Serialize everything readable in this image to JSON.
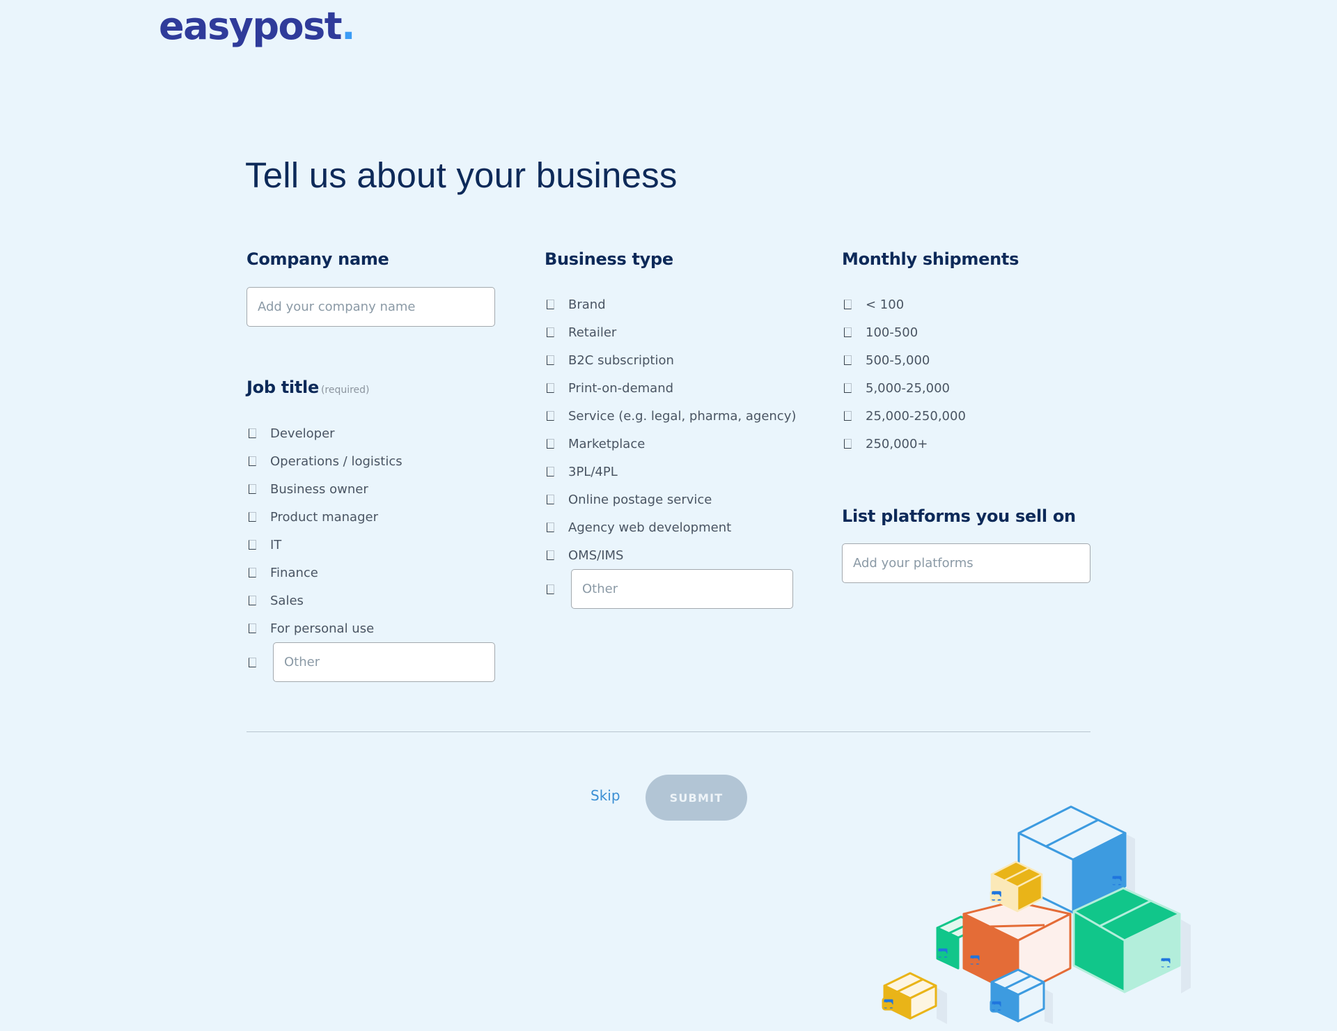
{
  "brand": {
    "name": "easypost",
    "dot": ".",
    "accent": "#3b9cf5",
    "logo_color": "#2f3b9a"
  },
  "page": {
    "title": "Tell us about your business",
    "background": "#eaf5fc"
  },
  "company": {
    "heading": "Company name",
    "placeholder": "Add your company name",
    "value": ""
  },
  "job_title": {
    "heading": "Job title",
    "required_note": "(required)",
    "options": [
      {
        "label": "Developer",
        "checked": false
      },
      {
        "label": "Operations / logistics",
        "checked": false
      },
      {
        "label": "Business owner",
        "checked": false
      },
      {
        "label": "Product manager",
        "checked": false
      },
      {
        "label": "IT",
        "checked": false
      },
      {
        "label": "Finance",
        "checked": false
      },
      {
        "label": "Sales",
        "checked": false
      },
      {
        "label": "For personal use",
        "checked": false
      }
    ],
    "other_placeholder": "Other",
    "other_value": ""
  },
  "business_type": {
    "heading": "Business type",
    "options": [
      {
        "label": "Brand",
        "checked": false
      },
      {
        "label": "Retailer",
        "checked": false
      },
      {
        "label": "B2C subscription",
        "checked": false
      },
      {
        "label": "Print-on-demand",
        "checked": false
      },
      {
        "label": "Service (e.g. legal, pharma, agency)",
        "checked": false
      },
      {
        "label": "Marketplace",
        "checked": false
      },
      {
        "label": "3PL/4PL",
        "checked": false
      },
      {
        "label": "Online postage service",
        "checked": false
      },
      {
        "label": "Agency web development",
        "checked": false
      },
      {
        "label": "OMS/IMS",
        "checked": false
      }
    ],
    "other_placeholder": "Other",
    "other_value": ""
  },
  "monthly_shipments": {
    "heading": "Monthly shipments",
    "options": [
      {
        "label": "< 100",
        "checked": false
      },
      {
        "label": "100-500",
        "checked": false
      },
      {
        "label": "500-5,000",
        "checked": false
      },
      {
        "label": "5,000-25,000",
        "checked": false
      },
      {
        "label": "25,000-250,000",
        "checked": false
      },
      {
        "label": "250,000+",
        "checked": false
      }
    ]
  },
  "platforms": {
    "heading": "List platforms you sell on",
    "placeholder": "Add your platforms",
    "value": ""
  },
  "actions": {
    "skip_label": "Skip",
    "submit_label": "SUBMIT",
    "submit_enabled": false,
    "skip_color": "#3b8fd4",
    "submit_color": "#b2c5d5"
  },
  "illustration": {
    "name": "stacked-boxes",
    "badge_text": "ep.",
    "colors": {
      "blue": "#3d9be0",
      "green": "#11c68a",
      "mint": "#b3eedb",
      "orange": "#e46c37",
      "peach": "#fdf0ec",
      "yellow": "#e9b418",
      "cream": "#fbe9b8",
      "badge": "#1f75de"
    }
  }
}
